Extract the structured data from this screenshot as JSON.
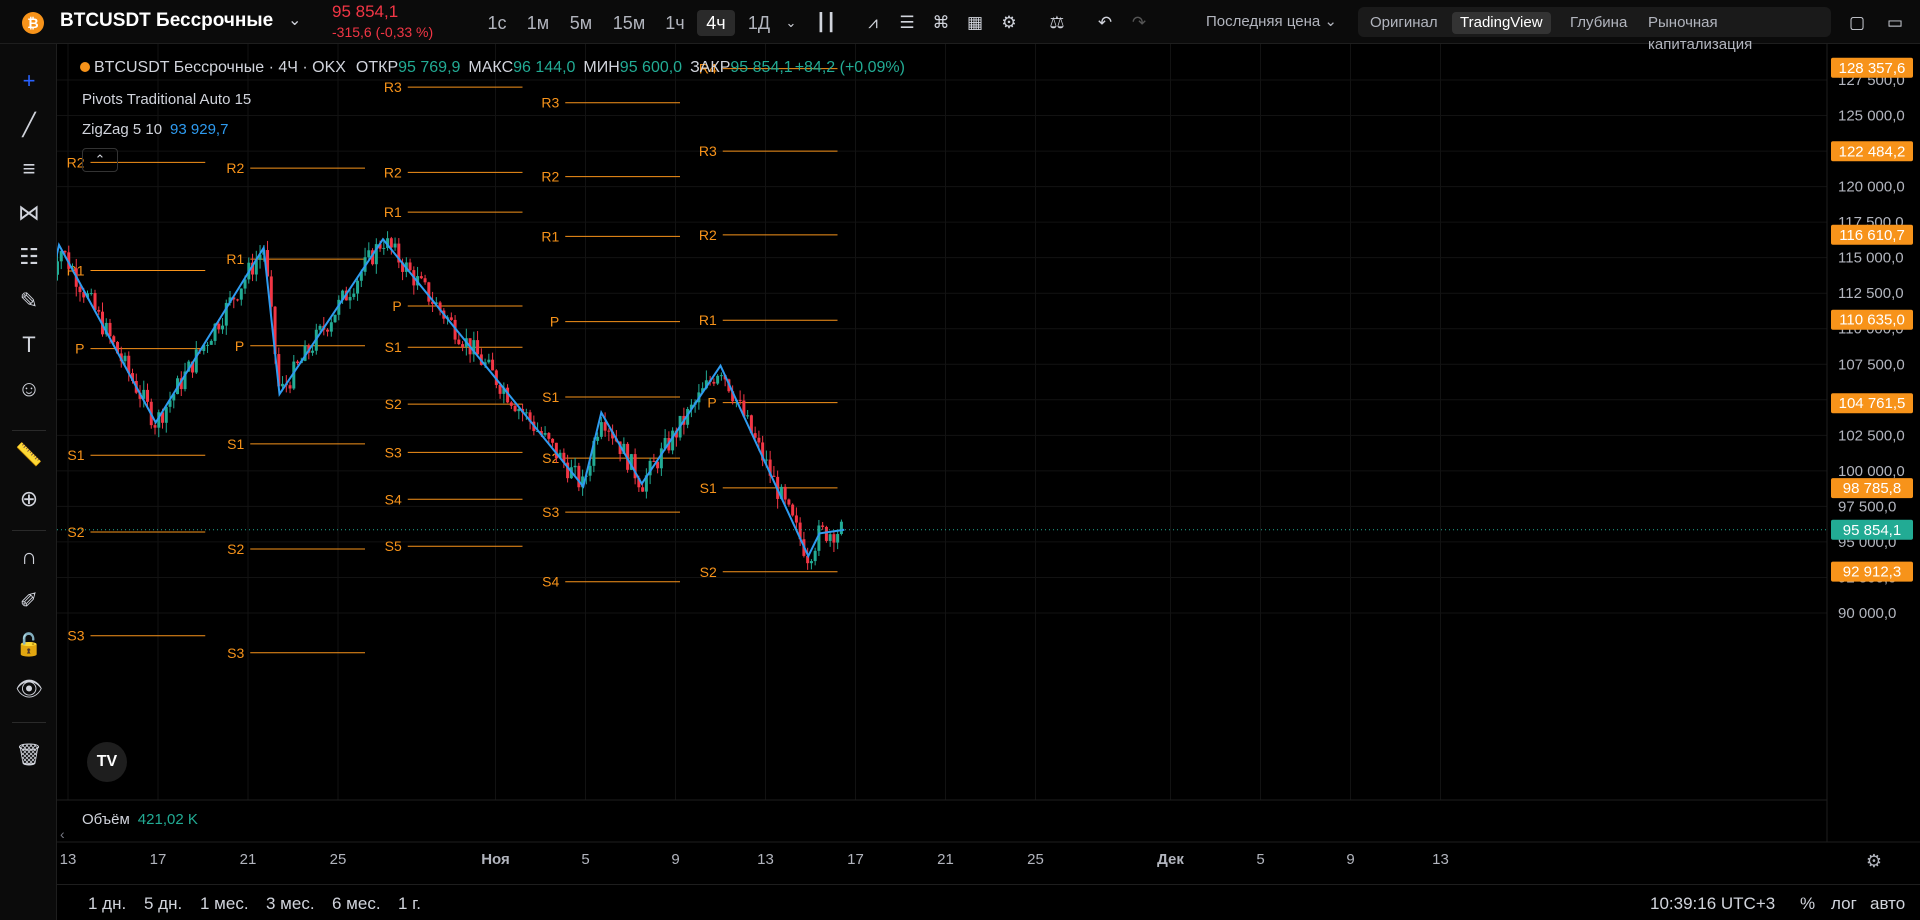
{
  "header": {
    "coin_letter": "₿",
    "symbol": "BTCUSDT Бессрочные",
    "last_price": "95 854,1",
    "change": "-315,6 (-0,33 %)",
    "timeframes": [
      "1с",
      "1м",
      "5м",
      "15м",
      "1ч",
      "4ч",
      "1Д"
    ],
    "active_timeframe": "4ч",
    "price_type": "Последняя цена",
    "views": [
      "Оригинал",
      "TradingView",
      "Глубина",
      "Рыночная капитализация"
    ],
    "active_view": "TradingView"
  },
  "legend": {
    "title": "BTCUSDT Бессрочные · 4Ч · OKX",
    "open_label": "ОТКР",
    "open": "95 769,9",
    "high_label": "МАКС",
    "high": "96 144,0",
    "low_label": "МИН",
    "low": "95 600,0",
    "close_label": "ЗАКР",
    "close": "95 854,1",
    "change": "+84,2 (+0,09%)",
    "pivots": "Pivots Traditional Auto 15",
    "zigzag": "ZigZag 5 10",
    "zigzag_value": "93 929,7",
    "volume_label": "Объём",
    "volume_value": "421,02 K"
  },
  "colors": {
    "up": "#22ab94",
    "down": "#f23645",
    "pivot": "#f7931a",
    "zigzag": "#2e9bf0",
    "last_price_badge": "#22ab94"
  },
  "chart_data": {
    "type": "candlestick",
    "y_ticks": [
      "127 500,0",
      "125 000,0",
      "122 500,0",
      "120 000,0",
      "117 500,0",
      "115 000,0",
      "112 500,0",
      "110 000,0",
      "107 500,0",
      "105 000,0",
      "102 500,0",
      "100 000,0",
      "97 500,0",
      "95 000,0",
      "92 500,0",
      "90 000,0"
    ],
    "y_tick_values": [
      127500,
      125000,
      122500,
      120000,
      117500,
      115000,
      112500,
      110000,
      107500,
      105000,
      102500,
      100000,
      97500,
      95000,
      92500,
      90000
    ],
    "price_badges": [
      {
        "label": "128 357,6",
        "value": 128357.6
      },
      {
        "label": "122 484,2",
        "value": 122484.2
      },
      {
        "label": "116 610,7",
        "value": 116610.7
      },
      {
        "label": "110 635,0",
        "value": 110635.0
      },
      {
        "label": "104 761,5",
        "value": 104761.5
      },
      {
        "label": "98 785,8",
        "value": 98785.8
      },
      {
        "label": "92 912,3",
        "value": 92912.3
      }
    ],
    "last_price": {
      "label": "95 854,1",
      "value": 95854.1
    },
    "x_ticks": [
      {
        "label": "13",
        "day": 13
      },
      {
        "label": "17",
        "day": 17
      },
      {
        "label": "21",
        "day": 21
      },
      {
        "label": "25",
        "day": 25
      },
      {
        "label": "Ноя",
        "day": 32
      },
      {
        "label": "5",
        "day": 36
      },
      {
        "label": "9",
        "day": 40
      },
      {
        "label": "13",
        "day": 44
      },
      {
        "label": "17",
        "day": 48
      },
      {
        "label": "21",
        "day": 52
      },
      {
        "label": "25",
        "day": 56
      },
      {
        "label": "Дек",
        "day": 62
      },
      {
        "label": "5",
        "day": 66
      },
      {
        "label": "9",
        "day": 70
      },
      {
        "label": "13",
        "day": 74
      }
    ],
    "zigzag": [
      {
        "day": 12.2,
        "price": 113000
      },
      {
        "day": 12.6,
        "price": 115900
      },
      {
        "day": 16.9,
        "price": 103400
      },
      {
        "day": 21.7,
        "price": 115700
      },
      {
        "day": 22.4,
        "price": 105400
      },
      {
        "day": 27.0,
        "price": 116300
      },
      {
        "day": 35.9,
        "price": 98900
      },
      {
        "day": 36.7,
        "price": 104100
      },
      {
        "day": 38.5,
        "price": 99100
      },
      {
        "day": 42.0,
        "price": 107400
      },
      {
        "day": 45.9,
        "price": 94000
      },
      {
        "day": 46.4,
        "price": 95600
      },
      {
        "day": 47.5,
        "price": 95854
      }
    ],
    "pivot_periods": [
      {
        "start": 14,
        "end": 19.1,
        "levels": [
          {
            "label": "R2",
            "value": 121700
          },
          {
            "label": "R1",
            "value": 114100
          },
          {
            "label": "P",
            "value": 108600
          },
          {
            "label": "S1",
            "value": 101100
          },
          {
            "label": "S2",
            "value": 95700
          },
          {
            "label": "S3",
            "value": 88400
          }
        ]
      },
      {
        "start": 21.1,
        "end": 26.2,
        "levels": [
          {
            "label": "R2",
            "value": 121300
          },
          {
            "label": "R1",
            "value": 114900
          },
          {
            "label": "P",
            "value": 108800
          },
          {
            "label": "S1",
            "value": 101900
          },
          {
            "label": "S2",
            "value": 94500
          },
          {
            "label": "S3",
            "value": 87200
          }
        ]
      },
      {
        "start": 28.1,
        "end": 33.2,
        "levels": [
          {
            "label": "R3",
            "value": 127000
          },
          {
            "label": "R2",
            "value": 121000
          },
          {
            "label": "R1",
            "value": 118200
          },
          {
            "label": "P",
            "value": 111600
          },
          {
            "label": "S1",
            "value": 108700
          },
          {
            "label": "S2",
            "value": 104700
          },
          {
            "label": "S3",
            "value": 101300
          },
          {
            "label": "S4",
            "value": 98000
          },
          {
            "label": "S5",
            "value": 94700
          }
        ]
      },
      {
        "start": 35.1,
        "end": 40.2,
        "levels": [
          {
            "label": "R3",
            "value": 125900
          },
          {
            "label": "R2",
            "value": 120700
          },
          {
            "label": "R1",
            "value": 116500
          },
          {
            "label": "P",
            "value": 110500
          },
          {
            "label": "S1",
            "value": 105200
          },
          {
            "label": "S2",
            "value": 100900
          },
          {
            "label": "S3",
            "value": 97100
          },
          {
            "label": "S4",
            "value": 92200
          }
        ]
      },
      {
        "start": 42.1,
        "end": 47.2,
        "levels": [
          {
            "label": "R4",
            "value": 128300
          },
          {
            "label": "R3",
            "value": 122500
          },
          {
            "label": "R2",
            "value": 116600
          },
          {
            "label": "R1",
            "value": 110600
          },
          {
            "label": "P",
            "value": 104800
          },
          {
            "label": "S1",
            "value": 98800
          },
          {
            "label": "S2",
            "value": 92900
          }
        ]
      }
    ]
  },
  "bottom": {
    "ranges": [
      "1 дн.",
      "5 дн.",
      "1 мес.",
      "3 мес.",
      "6 мес.",
      "1 г."
    ],
    "clock": "10:39:16 UTC+3",
    "percent": "%",
    "log": "лог",
    "auto": "авто"
  }
}
